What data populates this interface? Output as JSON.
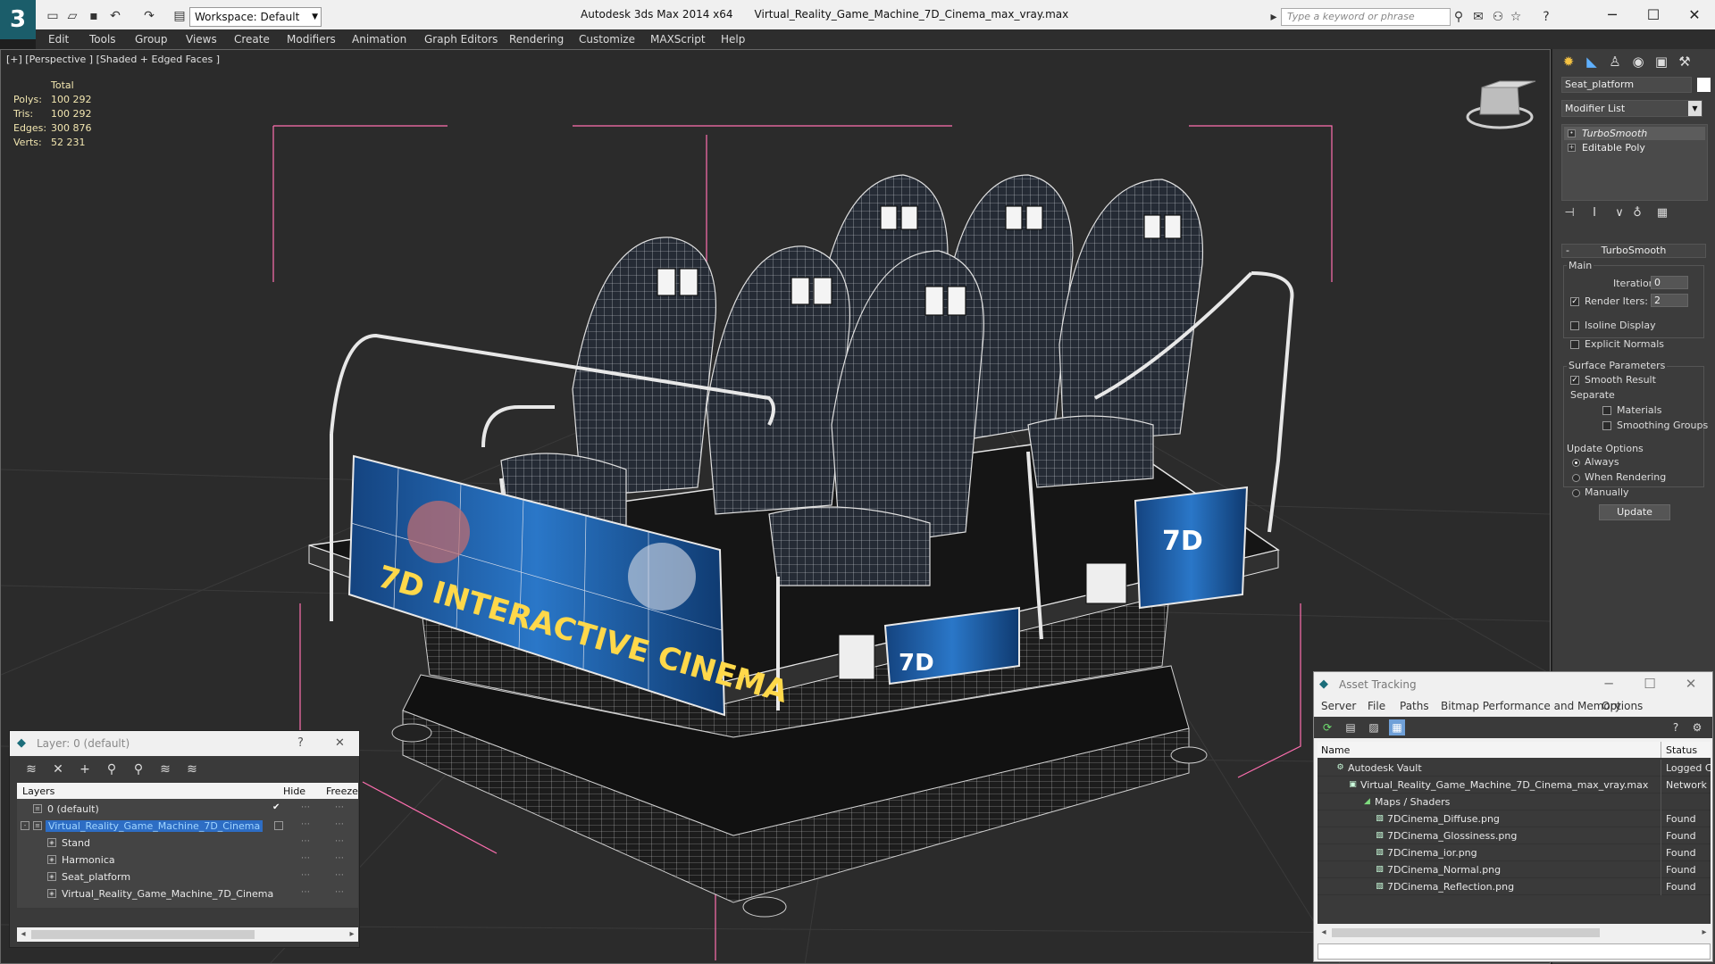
{
  "titlebar": {
    "workspace": "Workspace: Default",
    "app_title": "Autodesk 3ds Max  2014 x64",
    "file_title": "Virtual_Reality_Game_Machine_7D_Cinema_max_vray.max",
    "search_placeholder": "Type a keyword or phrase"
  },
  "menu": [
    "Edit",
    "Tools",
    "Group",
    "Views",
    "Create",
    "Modifiers",
    "Animation",
    "Graph Editors",
    "Rendering",
    "Customize",
    "MAXScript",
    "Help"
  ],
  "viewport": {
    "label": "[+] [Perspective ] [Shaded + Edged Faces ]",
    "stats": {
      "header": "Total",
      "rows": [
        {
          "label": "Polys:",
          "value": "100 292"
        },
        {
          "label": "Tris:",
          "value": "100 292"
        },
        {
          "label": "Edges:",
          "value": "300 876"
        },
        {
          "label": "Verts:",
          "value": "52 231"
        }
      ]
    },
    "banner_text": "7D INTERACTIVE CINEMA",
    "side_banner_text": "7D",
    "colors": {
      "wire": "#dcdcdc",
      "bounds": "#ff6fb0",
      "banner": "#1e5fa8",
      "seat": "#2a2f3a"
    }
  },
  "command_panel": {
    "object_name": "Seat_platform",
    "modifier_list": "Modifier List",
    "stack": [
      "TurboSmooth",
      "Editable Poly"
    ],
    "rollout_title": "TurboSmooth",
    "main_label": "Main",
    "iterations_label": "Iterations:",
    "iterations_value": "0",
    "render_iters_label": "Render Iters:",
    "render_iters_value": "2",
    "isoline_label": "Isoline Display",
    "explicit_label": "Explicit Normals",
    "surface_label": "Surface Parameters",
    "smooth_label": "Smooth Result",
    "separate_label": "Separate",
    "materials_label": "Materials",
    "smoothing_label": "Smoothing Groups",
    "update_options_label": "Update Options",
    "always_label": "Always",
    "when_render_label": "When Rendering",
    "manually_label": "Manually",
    "update_button": "Update"
  },
  "layer_dialog": {
    "title": "Layer: 0 (default)",
    "help": "?",
    "col_layers": "Layers",
    "col_hide": "Hide",
    "col_freeze": "Freeze",
    "rows": [
      {
        "name": "0 (default)"
      },
      {
        "name": "Virtual_Reality_Game_Machine_7D_Cinema"
      },
      {
        "name": "Stand"
      },
      {
        "name": "Harmonica"
      },
      {
        "name": "Seat_platform"
      },
      {
        "name": "Virtual_Reality_Game_Machine_7D_Cinema"
      }
    ]
  },
  "asset_dialog": {
    "title": "Asset Tracking",
    "menu": [
      "Server",
      "File",
      "Paths",
      "Bitmap Performance and Memory",
      "Options"
    ],
    "col_name": "Name",
    "col_status": "Status",
    "rows": [
      {
        "name": "Autodesk Vault",
        "status": "Logged C"
      },
      {
        "name": "Virtual_Reality_Game_Machine_7D_Cinema_max_vray.max",
        "status": "Network I"
      },
      {
        "name": "Maps / Shaders",
        "status": ""
      },
      {
        "name": "7DCinema_Diffuse.png",
        "status": "Found"
      },
      {
        "name": "7DCinema_Glossiness.png",
        "status": "Found"
      },
      {
        "name": "7DCinema_ior.png",
        "status": "Found"
      },
      {
        "name": "7DCinema_Normal.png",
        "status": "Found"
      },
      {
        "name": "7DCinema_Reflection.png",
        "status": "Found"
      }
    ]
  }
}
